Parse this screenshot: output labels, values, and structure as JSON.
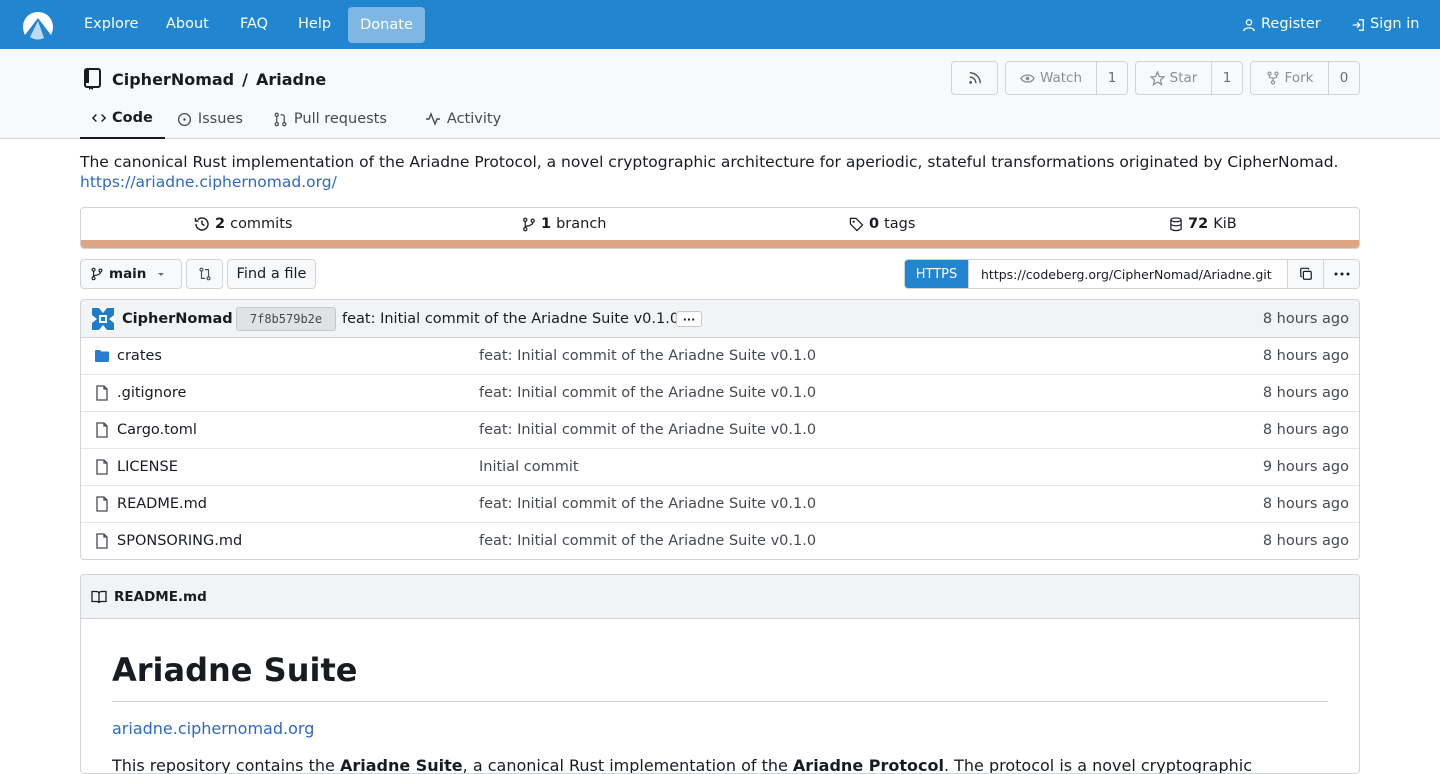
{
  "nav": {
    "explore": "Explore",
    "about": "About",
    "faq": "FAQ",
    "help": "Help",
    "donate": "Donate",
    "register": "Register",
    "signin": "Sign in"
  },
  "repo": {
    "owner": "CipherNomad",
    "separator": "/",
    "name": "Ariadne",
    "watch_label": "Watch",
    "watch_count": "1",
    "star_label": "Star",
    "star_count": "1",
    "fork_label": "Fork",
    "fork_count": "0"
  },
  "tabs": [
    {
      "label": "Code"
    },
    {
      "label": "Issues"
    },
    {
      "label": "Pull requests"
    },
    {
      "label": "Activity"
    }
  ],
  "description": {
    "text": "The canonical Rust implementation of the Ariadne Protocol, a novel cryptographic architecture for aperiodic, stateful transformations originated by CipherNomad.",
    "url": "https://ariadne.ciphernomad.org/"
  },
  "stats": {
    "commits_count": "2",
    "commits_label": "commits",
    "branch_count": "1",
    "branch_label": "branch",
    "tags_count": "0",
    "tags_label": "tags",
    "size_value": "72",
    "size_unit": "KiB",
    "language_color": "#dea584"
  },
  "branch": {
    "name": "main",
    "find_file": "Find a file",
    "protocol": "HTTPS",
    "clone_url": "https://codeberg.org/CipherNomad/Ariadne.git"
  },
  "latest_commit": {
    "author": "CipherNomad",
    "sha": "7f8b579b2e",
    "message": "feat: Initial commit of the Ariadne Suite v0.1.0",
    "ellipsis": "···",
    "time": "8 hours ago"
  },
  "files": [
    {
      "name": "crates",
      "type": "folder",
      "commit": "feat: Initial commit of the Ariadne Suite v0.1.0",
      "time": "8 hours ago"
    },
    {
      "name": ".gitignore",
      "type": "file",
      "commit": "feat: Initial commit of the Ariadne Suite v0.1.0",
      "time": "8 hours ago"
    },
    {
      "name": "Cargo.toml",
      "type": "file",
      "commit": "feat: Initial commit of the Ariadne Suite v0.1.0",
      "time": "8 hours ago"
    },
    {
      "name": "LICENSE",
      "type": "file",
      "commit": "Initial commit",
      "time": "9 hours ago"
    },
    {
      "name": "README.md",
      "type": "file",
      "commit": "feat: Initial commit of the Ariadne Suite v0.1.0",
      "time": "8 hours ago"
    },
    {
      "name": "SPONSORING.md",
      "type": "file",
      "commit": "feat: Initial commit of the Ariadne Suite v0.1.0",
      "time": "8 hours ago"
    }
  ],
  "readme": {
    "filename": "README.md",
    "title": "Ariadne Suite",
    "link": "ariadne.ciphernomad.org",
    "para_start": "This repository contains the",
    "para_bold1": "Ariadne Suite",
    "para_mid": ", a canonical Rust implementation of the",
    "para_bold2": "Ariadne Protocol",
    "para_end": ". The protocol is a novel cryptographic"
  },
  "colors": {
    "nav_bg": "#2185d0",
    "link": "#2d6ac0",
    "rust": "#dea584"
  }
}
